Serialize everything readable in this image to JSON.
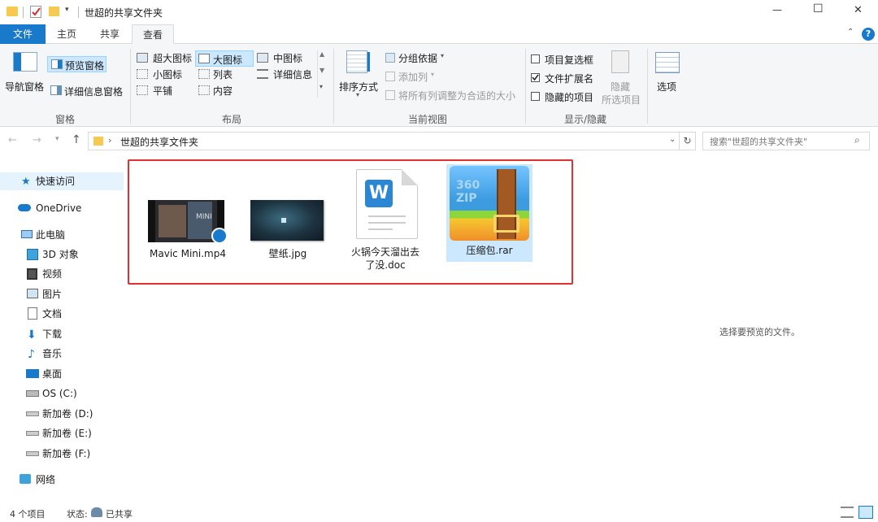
{
  "window": {
    "title": "世超的共享文件夹",
    "minimize_glyph": "—",
    "maximize_glyph": "☐",
    "close_glyph": "✕"
  },
  "tabs": {
    "file": "文件",
    "home": "主页",
    "share": "共享",
    "view": "查看"
  },
  "ribbon": {
    "panes": {
      "nav_pane": "导航窗格",
      "preview_pane": "预览窗格",
      "details_pane": "详细信息窗格",
      "group": "窗格"
    },
    "layout": {
      "xl_icons": "超大图标",
      "large_icons": "大图标",
      "medium_icons": "中图标",
      "small_icons": "小图标",
      "list": "列表",
      "details": "详细信息",
      "tiles": "平铺",
      "content": "内容",
      "group": "布局"
    },
    "current_view": {
      "sort_by": "排序方式",
      "group_by": "分组依据",
      "add_columns": "添加列",
      "size_all_columns": "将所有列调整为合适的大小",
      "group": "当前视图"
    },
    "show_hide": {
      "item_checkboxes": "项目复选框",
      "file_extensions": "文件扩展名",
      "hidden_items": "隐藏的项目",
      "hide_selected_1": "隐藏",
      "hide_selected_2": "所选项目",
      "options": "选项",
      "group": "显示/隐藏",
      "item_checkboxes_checked": false,
      "file_extensions_checked": true,
      "hidden_items_checked": false
    }
  },
  "address": {
    "path": "世超的共享文件夹",
    "search_placeholder": "搜索\"世超的共享文件夹\""
  },
  "nav": {
    "quick_access": "快速访问",
    "onedrive": "OneDrive",
    "this_pc": "此电脑",
    "objects3d": "3D 对象",
    "videos": "视频",
    "pictures": "图片",
    "documents": "文档",
    "downloads": "下载",
    "music": "音乐",
    "desktop": "桌面",
    "drive_c": "OS (C:)",
    "drive_d": "新加卷 (D:)",
    "drive_e": "新加卷 (E:)",
    "drive_f": "新加卷 (F:)",
    "network": "网络"
  },
  "files": [
    {
      "name": "Mavic Mini.mp4",
      "type": "video"
    },
    {
      "name": "壁纸.jpg",
      "type": "image"
    },
    {
      "name_line1": "火锅今天溜出去",
      "name_line2": "了没.doc",
      "type": "doc"
    },
    {
      "name": "压缩包.rar",
      "type": "archive",
      "zip_badge_line1": "360",
      "zip_badge_line2": "ZIP"
    }
  ],
  "thumbs": {
    "video_text": "MINI",
    "doc_letter": "W"
  },
  "preview_text": "选择要预览的文件。",
  "status": {
    "count": "4 个项目",
    "state_label": "状态:",
    "state_value": "已共享"
  },
  "colors": {
    "accent": "#1979ca",
    "highlight_border": "#e03030",
    "selection": "#cce8ff"
  }
}
